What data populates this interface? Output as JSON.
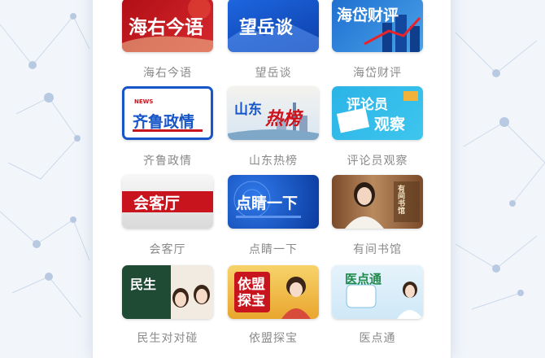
{
  "columns": [
    {
      "items": [
        {
          "key": "haiyou",
          "caption": "海右今语",
          "tile_text": "海右今语"
        },
        {
          "key": "qilu",
          "caption": "齐鲁政情",
          "tile_text": "齐鲁政情",
          "tile_sub": "NEWS"
        },
        {
          "key": "huike",
          "caption": "会客厅",
          "tile_text": "会客厅"
        },
        {
          "key": "minsheng",
          "caption": "民生对对碰",
          "tile_text": "民生"
        }
      ]
    },
    {
      "items": [
        {
          "key": "wangyue",
          "caption": "望岳谈",
          "tile_text": "望岳谈"
        },
        {
          "key": "shandong",
          "caption": "山东热榜",
          "tile_text_a": "山东",
          "tile_text_b": "热榜"
        },
        {
          "key": "dianjing",
          "caption": "点睛一下",
          "tile_text": "点睛一下"
        },
        {
          "key": "yimeng",
          "caption": "依盟探宝",
          "tile_text": "依盟探宝"
        }
      ]
    },
    {
      "items": [
        {
          "key": "haidai",
          "caption": "海岱财评",
          "tile_text": "海岱财评"
        },
        {
          "key": "pinglun",
          "caption": "评论员观察",
          "tile_text_a": "评论员",
          "tile_text_b": "观察"
        },
        {
          "key": "youjian",
          "caption": "有间书馆",
          "tile_text": "有间书馆"
        },
        {
          "key": "yidian",
          "caption": "医点通",
          "tile_text": "医点通"
        }
      ]
    }
  ],
  "colors": {
    "caption": "#8a8a8a",
    "red": "#c8141c",
    "blue": "#1756c8",
    "gold": "#e9b23a"
  }
}
